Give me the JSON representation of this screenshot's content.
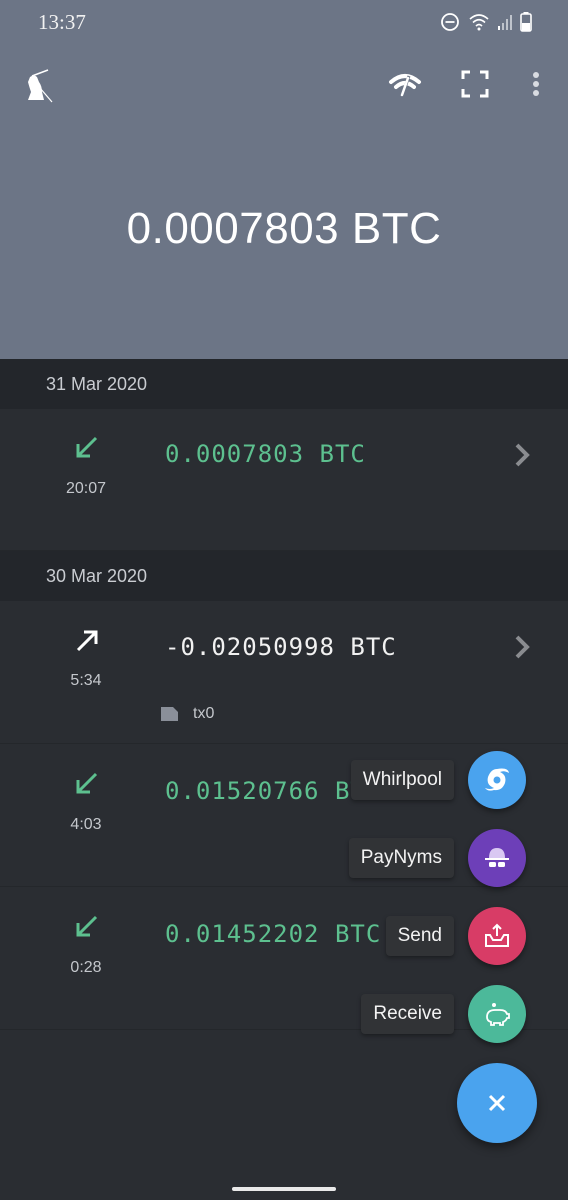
{
  "status_bar": {
    "time": "13:37",
    "icons": [
      "do-not-disturb-icon",
      "wifi-icon",
      "cell-signal-icon",
      "battery-icon"
    ]
  },
  "toolbar": {
    "logo": "samurai-logo",
    "actions": [
      "network-status-icon",
      "scan-qr-icon",
      "more-options-icon"
    ]
  },
  "balance": {
    "value": "0.0007803 BTC"
  },
  "colors": {
    "header_bg": "#6c7586",
    "incoming": "#5dc08f",
    "outgoing": "#f1f1f1",
    "whirlpool": "#4aa3ee",
    "paynyms": "#6d3fb8",
    "send": "#d83c66",
    "receive": "#4cb99a",
    "fab": "#4aa3ee"
  },
  "transactions": {
    "groups": [
      {
        "date": "31 Mar 2020",
        "items": [
          {
            "direction": "incoming",
            "time": "20:07",
            "amount": "0.0007803 BTC"
          }
        ]
      },
      {
        "date": "30 Mar 2020",
        "items": [
          {
            "direction": "outgoing",
            "time": "5:34",
            "amount": "-0.02050998 BTC",
            "note": "tx0"
          },
          {
            "direction": "incoming",
            "time": "4:03",
            "amount": "0.01520766 BTC"
          },
          {
            "direction": "incoming",
            "time": "0:28",
            "amount": "0.01452202 BTC"
          }
        ]
      }
    ]
  },
  "fab_menu": {
    "items": [
      {
        "label": "Whirlpool",
        "icon": "whirlpool-icon"
      },
      {
        "label": "PayNyms",
        "icon": "paynym-icon"
      },
      {
        "label": "Send",
        "icon": "send-icon"
      },
      {
        "label": "Receive",
        "icon": "receive-piggy-bank-icon"
      }
    ],
    "close_icon": "close-icon"
  }
}
